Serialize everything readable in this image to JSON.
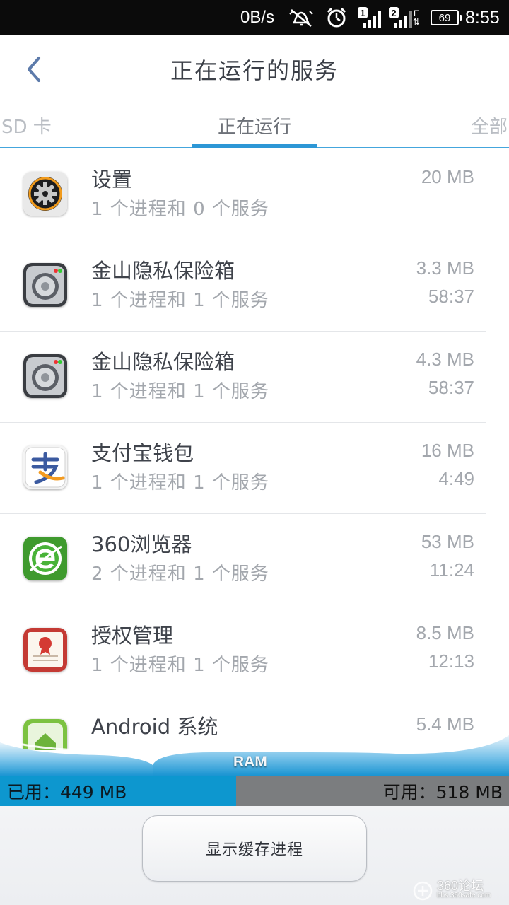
{
  "status_bar": {
    "speed": "0B/s",
    "signal1_badge": "1",
    "signal2_badge": "2",
    "network_letter": "E",
    "battery": "69",
    "time": "8:55"
  },
  "header": {
    "title": "正在运行的服务"
  },
  "tabs": [
    {
      "label": "SD 卡"
    },
    {
      "label": "正在运行"
    },
    {
      "label": "全部"
    }
  ],
  "services": [
    {
      "name": "设置",
      "sub": "1 个进程和 0 个服务",
      "size": "20 MB",
      "time": "",
      "icon": "settings-gear-icon"
    },
    {
      "name": "金山隐私保险箱",
      "sub": "1 个进程和 1 个服务",
      "size": "3.3 MB",
      "time": "58:37",
      "icon": "vault-icon"
    },
    {
      "name": "金山隐私保险箱",
      "sub": "1 个进程和 1 个服务",
      "size": "4.3 MB",
      "time": "58:37",
      "icon": "vault-icon"
    },
    {
      "name": "支付宝钱包",
      "sub": "1 个进程和 1 个服务",
      "size": "16 MB",
      "time": "4:49",
      "icon": "alipay-icon"
    },
    {
      "name": "360浏览器",
      "sub": "2 个进程和 1 个服务",
      "size": "53 MB",
      "time": "11:24",
      "icon": "browser-e-icon"
    },
    {
      "name": "授权管理",
      "sub": "1 个进程和 1 个服务",
      "size": "8.5 MB",
      "time": "12:13",
      "icon": "certificate-icon"
    },
    {
      "name": "Android 系统",
      "sub": "",
      "size": "5.4 MB",
      "time": "",
      "icon": "android-home-icon"
    }
  ],
  "ram": {
    "label": "RAM",
    "used_text": "已用：449 MB",
    "free_text": "可用：518 MB",
    "used_fraction": 0.464
  },
  "footer": {
    "cache_button": "显示缓存进程",
    "watermark_main": "360论坛",
    "watermark_sub": "bbs.360safe.com"
  },
  "colors": {
    "accent": "#2d97d6",
    "ram_used": "#0d97cf",
    "ram_free": "#7b7d7f"
  }
}
